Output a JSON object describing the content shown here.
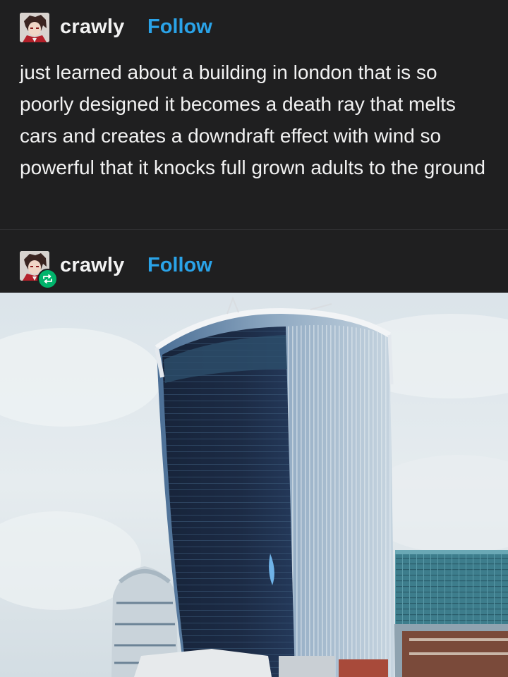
{
  "post": {
    "username": "crawly",
    "follow_label": "Follow",
    "text": "just learned about a building in london that is so poorly designed it becomes a death ray that melts cars and creates a downdraft effect with wind so powerful that it knocks full grown adults to the ground"
  },
  "reblog": {
    "username": "crawly",
    "follow_label": "Follow",
    "badge_icon": "reblog-icon"
  },
  "colors": {
    "background": "#1f1f20",
    "follow": "#2aa3e8",
    "reblog_badge": "#00b36b"
  },
  "image": {
    "subject": "walkie-talkie-skyscraper-photo"
  }
}
